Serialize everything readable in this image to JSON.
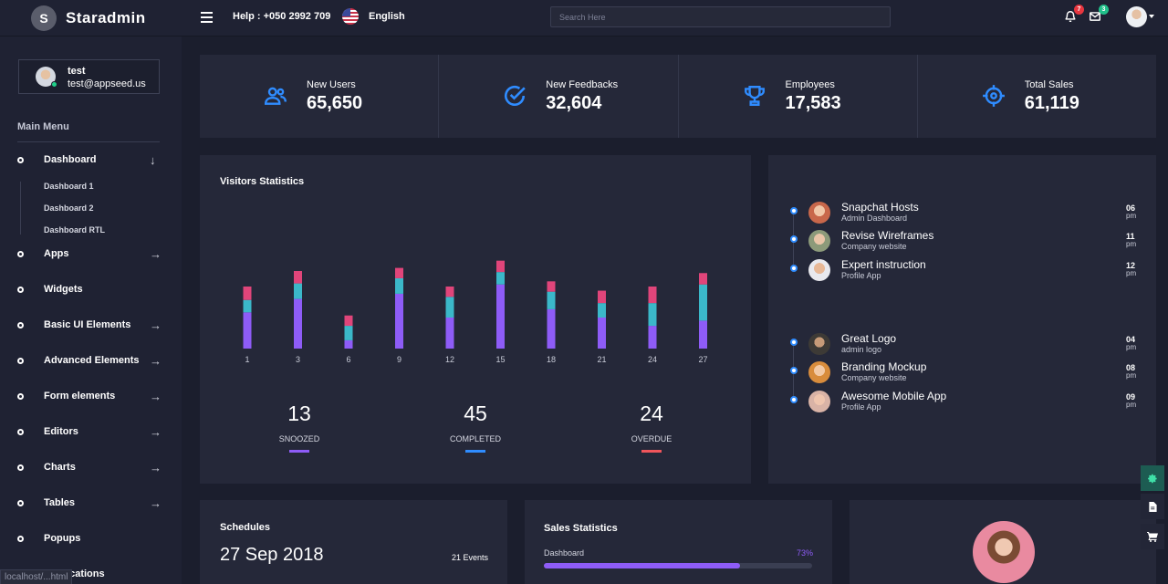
{
  "header": {
    "brand_initial": "S",
    "brand_name": "Staradmin",
    "help": "Help : +050 2992 709",
    "language": "English",
    "search_placeholder": "Search Here",
    "notifications_count": "7",
    "messages_count": "3"
  },
  "sidebar": {
    "user_name": "test",
    "user_email": "test@appseed.us",
    "menu_heading": "Main Menu",
    "items": [
      {
        "label": "Dashboard",
        "arrow": "↓"
      },
      {
        "label": "Apps",
        "arrow": "→"
      },
      {
        "label": "Widgets",
        "arrow": ""
      },
      {
        "label": "Basic UI Elements",
        "arrow": "→"
      },
      {
        "label": "Advanced Elements",
        "arrow": "→"
      },
      {
        "label": "Form elements",
        "arrow": "→"
      },
      {
        "label": "Editors",
        "arrow": "→"
      },
      {
        "label": "Charts",
        "arrow": "→"
      },
      {
        "label": "Tables",
        "arrow": "→"
      },
      {
        "label": "Popups",
        "arrow": ""
      },
      {
        "label": "Notifications",
        "arrow": ""
      }
    ],
    "subitems": [
      "Dashboard 1",
      "Dashboard 2",
      "Dashboard RTL"
    ],
    "status_url": "localhost/...html"
  },
  "stats": [
    {
      "label": "New Users",
      "value": "65,650",
      "icon": "users-icon"
    },
    {
      "label": "New Feedbacks",
      "value": "32,604",
      "icon": "check-circle-icon"
    },
    {
      "label": "Employees",
      "value": "17,583",
      "icon": "trophy-icon"
    },
    {
      "label": "Total Sales",
      "value": "61,119",
      "icon": "crosshair-icon"
    }
  ],
  "visitors": {
    "title": "Visitors Statistics",
    "summary": [
      {
        "value": "13",
        "label": "SNOOZED",
        "color": "#8e5cf7"
      },
      {
        "value": "45",
        "label": "COMPLETED",
        "color": "#2f8cff"
      },
      {
        "value": "24",
        "label": "OVERDUE",
        "color": "#f0555b"
      }
    ]
  },
  "chart_data": {
    "type": "bar",
    "stacked": true,
    "categories": [
      "1",
      "3",
      "6",
      "9",
      "12",
      "15",
      "18",
      "21",
      "24",
      "27"
    ],
    "series": [
      {
        "color": "#8e5cf7",
        "values": [
          35,
          48,
          8,
          53,
          30,
          62,
          38,
          30,
          22,
          27
        ]
      },
      {
        "color": "#3bb8c9",
        "values": [
          12,
          15,
          14,
          15,
          20,
          12,
          17,
          14,
          22,
          35
        ]
      },
      {
        "color": "#e0457a",
        "values": [
          13,
          12,
          10,
          10,
          10,
          11,
          10,
          12,
          16,
          11
        ]
      }
    ],
    "ylim": [
      0,
      90
    ],
    "grid": false
  },
  "timeline": [
    {
      "title": "Snapchat Hosts",
      "sub": "Admin Dashboard",
      "time": "06",
      "ampm": "pm"
    },
    {
      "title": "Revise Wireframes",
      "sub": "Company website",
      "time": "11",
      "ampm": "pm"
    },
    {
      "title": "Expert instruction",
      "sub": "Profile App",
      "time": "12",
      "ampm": "pm"
    },
    {
      "title": "Great Logo",
      "sub": "admin logo",
      "time": "04",
      "ampm": "pm"
    },
    {
      "title": "Branding Mockup",
      "sub": "Company website",
      "time": "08",
      "ampm": "pm"
    },
    {
      "title": "Awesome Mobile App",
      "sub": "Profile App",
      "time": "09",
      "ampm": "pm"
    }
  ],
  "schedules": {
    "title": "Schedules",
    "date": "27 Sep 2018",
    "events": "21 Events"
  },
  "sales": {
    "title": "Sales Statistics",
    "label": "Dashboard",
    "percent": "73%",
    "fraction": 0.73
  },
  "colors": {
    "accent": "#2f8cff",
    "purple": "#8e5cf7",
    "teal": "#3bb8c9",
    "pink": "#e0457a",
    "red": "#f0555b",
    "settings": "#1d5c52"
  }
}
